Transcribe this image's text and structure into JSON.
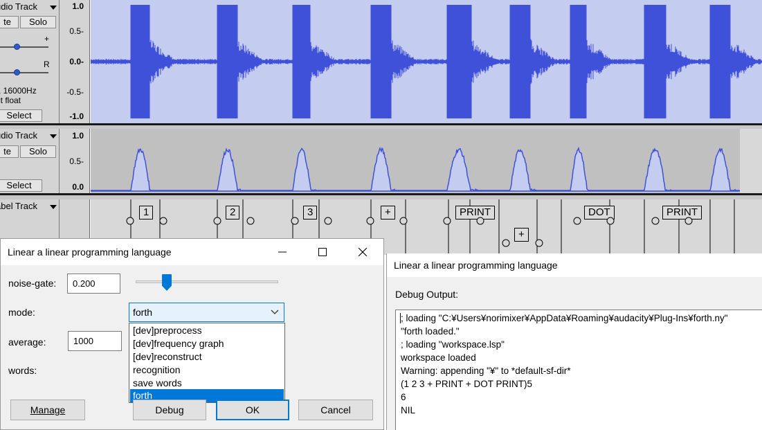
{
  "tracks": [
    {
      "name": "udio Track",
      "mute_label": "te",
      "solo_label": "Solo",
      "gain_label": "+",
      "pan_label": "R",
      "info_line1": ", 16000Hz",
      "info_line2": "it float",
      "select_label": "Select"
    },
    {
      "name": "udio Track",
      "mute_label": "te",
      "solo_label": "Solo",
      "select_label": "Select"
    },
    {
      "name": "abel Track"
    }
  ],
  "ruler1": [
    "1.0",
    "0.5-",
    "0.0-",
    "-0.5-",
    "-1.0"
  ],
  "ruler2": [
    "1.0",
    "0.5-",
    "0.0"
  ],
  "labels": [
    "1",
    "2",
    "3",
    "+",
    "PRINT",
    "+",
    "DOT",
    "PRINT"
  ],
  "colors": {
    "waveform": "#3f51d9",
    "wave_bg": "#c4ccf0",
    "accent": "#0078d7"
  },
  "dialog1": {
    "title": "Linear a linear programming language",
    "noise_gate_label": "noise-gate:",
    "noise_gate_value": "0.200",
    "mode_label": "mode:",
    "mode_value": "forth",
    "average_label": "average:",
    "average_value": "1000",
    "words_label": "words:",
    "mode_options": [
      "[dev]preprocess",
      "[dev]frequency graph",
      "[dev]reconstruct",
      "recognition",
      "save words",
      "forth"
    ],
    "manage_label": "Manage",
    "debug_label": "Debug",
    "ok_label": "OK",
    "cancel_label": "Cancel"
  },
  "dialog2": {
    "title": "Linear a linear programming language",
    "debug_output_label": "Debug Output:",
    "lines": [
      "; loading \"C:¥Users¥norimixer¥AppData¥Roaming¥audacity¥Plug-Ins¥forth.ny\"",
      "\"forth loaded.\"",
      "; loading \"workspace.lsp\"",
      "workspace loaded",
      "Warning: appending \"¥\" to *default-sf-dir*",
      "(1 2 3 + PRINT + DOT PRINT)5",
      "6",
      "NIL"
    ]
  }
}
